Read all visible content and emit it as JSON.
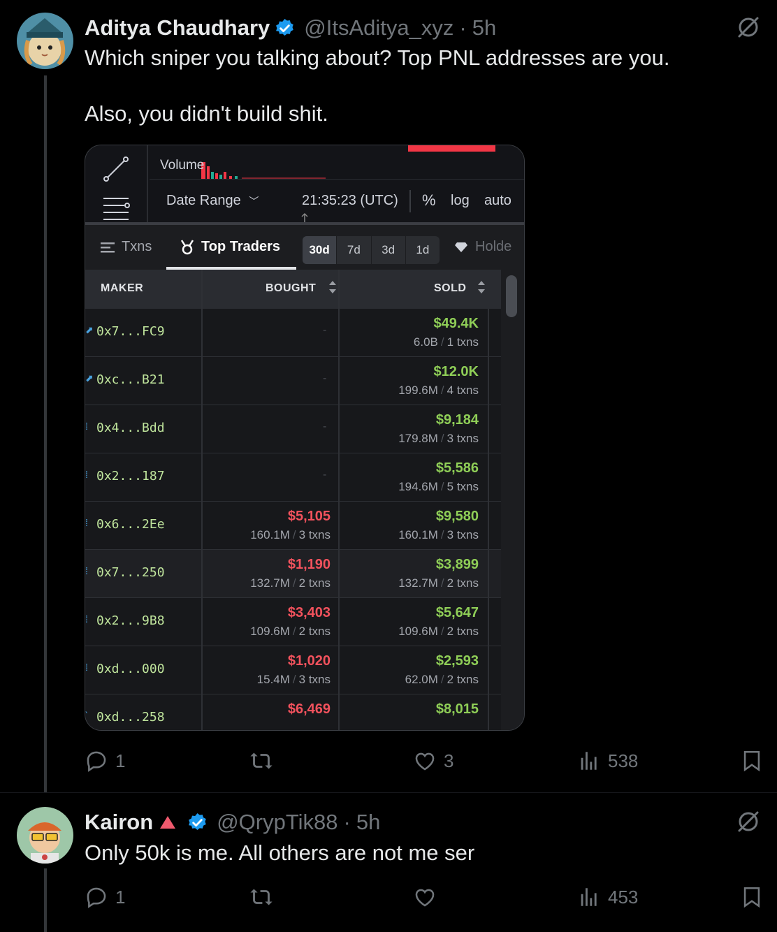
{
  "tweets": [
    {
      "author_name": "Aditya Chaudhary",
      "handle": "@ItsAditya_xyz",
      "separator": "·",
      "time": "5h",
      "text_lines": [
        "Which sniper you talking about? Top PNL addresses are you.",
        "Also, you didn't build shit."
      ],
      "actions": {
        "replies": "1",
        "reposts": "",
        "likes": "3",
        "views": "538"
      }
    },
    {
      "author_name": "Kairon",
      "handle": "@QrypTik88",
      "separator": "·",
      "time": "5h",
      "text_lines": [
        "Only 50k is me. All others are not me ser"
      ],
      "actions": {
        "replies": "1",
        "reposts": "",
        "likes": "",
        "views": "453"
      }
    }
  ],
  "media": {
    "volume_label": "Volume",
    "date_range": "Date Range",
    "clock": "21:35:23 (UTC)",
    "pct": "%",
    "log": "log",
    "auto": "auto",
    "tabs": {
      "txns": "Txns",
      "top_traders": "Top Traders",
      "holders": "Holde"
    },
    "periods": [
      "30d",
      "7d",
      "3d",
      "1d"
    ],
    "headers": {
      "maker": "MAKER",
      "bought": "BOUGHT",
      "sold": "SOLD"
    },
    "rows": [
      {
        "maker": "0x7...FC9",
        "bought": "",
        "bought_sub": "",
        "bought_txns": "",
        "sold": "$49.4K",
        "sold_sub": "6.0B",
        "sold_txns": "1 txns"
      },
      {
        "maker": "0xc...B21",
        "bought": "",
        "bought_sub": "",
        "bought_txns": "",
        "sold": "$12.0K",
        "sold_sub": "199.6M",
        "sold_txns": "4 txns"
      },
      {
        "maker": "0x4...Bdd",
        "bought": "",
        "bought_sub": "",
        "bought_txns": "",
        "sold": "$9,184",
        "sold_sub": "179.8M",
        "sold_txns": "3 txns"
      },
      {
        "maker": "0x2...187",
        "bought": "",
        "bought_sub": "",
        "bought_txns": "",
        "sold": "$5,586",
        "sold_sub": "194.6M",
        "sold_txns": "5 txns"
      },
      {
        "maker": "0x6...2Ee",
        "bought": "$5,105",
        "bought_sub": "160.1M",
        "bought_txns": "3 txns",
        "sold": "$9,580",
        "sold_sub": "160.1M",
        "sold_txns": "3 txns"
      },
      {
        "maker": "0x7...250",
        "bought": "$1,190",
        "bought_sub": "132.7M",
        "bought_txns": "2 txns",
        "sold": "$3,899",
        "sold_sub": "132.7M",
        "sold_txns": "2 txns"
      },
      {
        "maker": "0x2...9B8",
        "bought": "$3,403",
        "bought_sub": "109.6M",
        "bought_txns": "2 txns",
        "sold": "$5,647",
        "sold_sub": "109.6M",
        "sold_txns": "2 txns"
      },
      {
        "maker": "0xd...000",
        "bought": "$1,020",
        "bought_sub": "15.4M",
        "bought_txns": "3 txns",
        "sold": "$2,593",
        "sold_sub": "62.0M",
        "sold_txns": "2 txns"
      },
      {
        "maker": "0xd...258",
        "bought": "$6,469",
        "bought_sub": "",
        "bought_txns": "",
        "sold": "$8,015",
        "sold_sub": "",
        "sold_txns": ""
      }
    ],
    "dash": "-",
    "slash": "/"
  },
  "colors": {
    "bg": "#000000",
    "verified": "#1d9bf0",
    "buy": "#f2525d",
    "sell": "#8fce57",
    "muted": "#71767b"
  },
  "icons": [
    "verified-icon",
    "grok-icon",
    "reply-icon",
    "repost-icon",
    "like-icon",
    "views-icon",
    "bookmark-icon",
    "triangle-icon"
  ]
}
